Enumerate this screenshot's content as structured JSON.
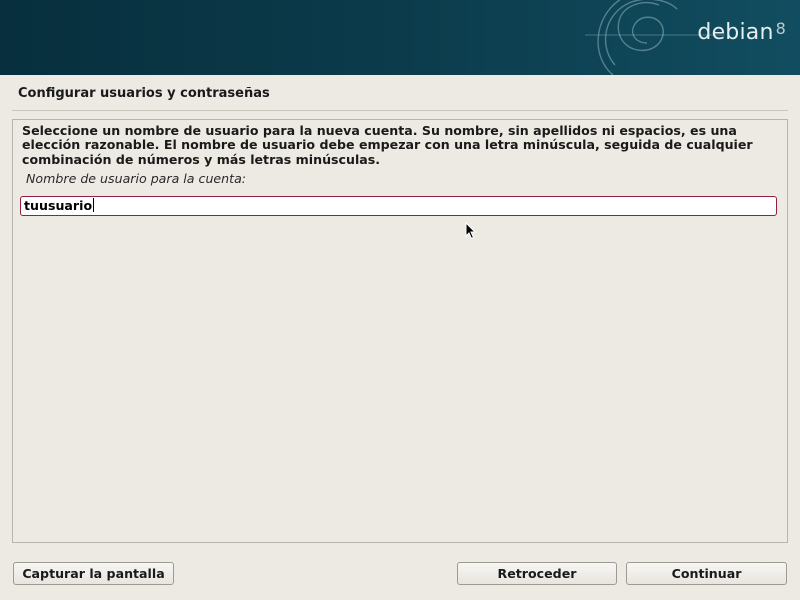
{
  "banner": {
    "brand": "debian",
    "version": "8"
  },
  "page": {
    "title": "Configurar usuarios y contraseñas"
  },
  "main": {
    "description": "Seleccione un nombre de usuario para la nueva cuenta. Su nombre, sin apellidos ni espacios, es una elección razonable. El nombre de usuario debe empezar con una letra minúscula, seguida de cualquier combinación de números y más letras minúsculas.",
    "field_label": "Nombre de usuario para la cuenta:",
    "field_value": "tuusuario"
  },
  "buttons": {
    "screenshot": "Capturar la pantalla",
    "back": "Retroceder",
    "continue": "Continuar"
  },
  "colors": {
    "banner": "#0b3a4a",
    "background": "#edeae4",
    "input_focus_border": "#8e2243"
  },
  "icons": {
    "banner_decoration": "debian-swirl-icon",
    "pointer": "mouse-pointer-icon"
  }
}
